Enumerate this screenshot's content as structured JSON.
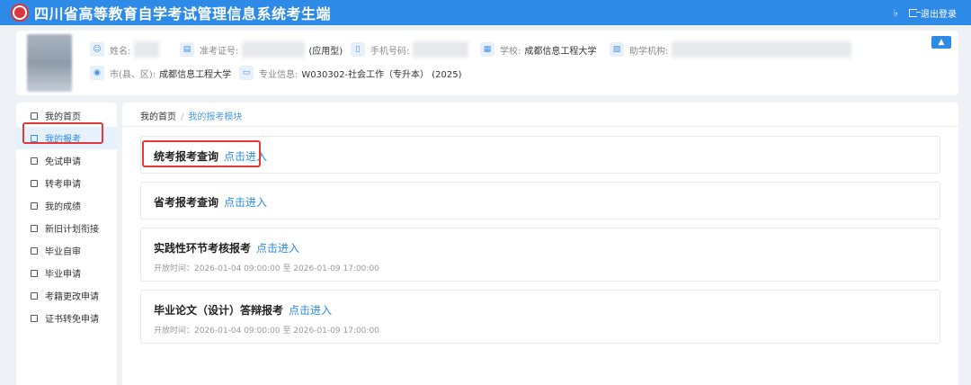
{
  "header": {
    "title": "四川省高等教育自学考试管理信息系统考生端",
    "logout_label": "退出登录"
  },
  "profile": {
    "name_label": "姓名:",
    "ticket_label": "准考证号:",
    "ticket_suffix": "(应用型)",
    "phone_label": "手机号码:",
    "school_label": "学校:",
    "school_value": "成都信息工程大学",
    "agency_label": "助学机构:",
    "city_label": "市(县、区):",
    "city_value": "成都信息工程大学",
    "major_label": "专业信息:",
    "major_value": "W030302-社会工作（专升本） (2025)"
  },
  "sidebar": {
    "items": [
      {
        "label": "我的首页",
        "icon": "home-icon"
      },
      {
        "label": "我的报考",
        "icon": "briefcase-icon"
      },
      {
        "label": "免试申请",
        "icon": "document-icon"
      },
      {
        "label": "转考申请",
        "icon": "transfer-icon"
      },
      {
        "label": "我的成绩",
        "icon": "grades-icon"
      },
      {
        "label": "新旧计划衔接",
        "icon": "link-icon"
      },
      {
        "label": "毕业自审",
        "icon": "review-icon"
      },
      {
        "label": "毕业申请",
        "icon": "user-icon"
      },
      {
        "label": "考籍更改申请",
        "icon": "edit-icon"
      },
      {
        "label": "证书转免申请",
        "icon": "certificate-icon"
      }
    ]
  },
  "breadcrumb": {
    "home": "我的首页",
    "separator": "/",
    "current": "我的报考模块"
  },
  "cards": [
    {
      "title": "统考报考查询",
      "link": "点击进入",
      "time": ""
    },
    {
      "title": "省考报考查询",
      "link": "点击进入",
      "time": ""
    },
    {
      "title": "实践性环节考核报考",
      "link": "点击进入",
      "time": "开放时间：2026-01-04 09:00:00 至 2026-01-09 17:00:00"
    },
    {
      "title": "毕业论文（设计）答辩报考",
      "link": "点击进入",
      "time": "开放时间：2026-01-04 09:00:00 至 2026-01-09 17:00:00"
    }
  ],
  "colors": {
    "primary": "#2d8ae6",
    "highlight": "#e53935"
  }
}
